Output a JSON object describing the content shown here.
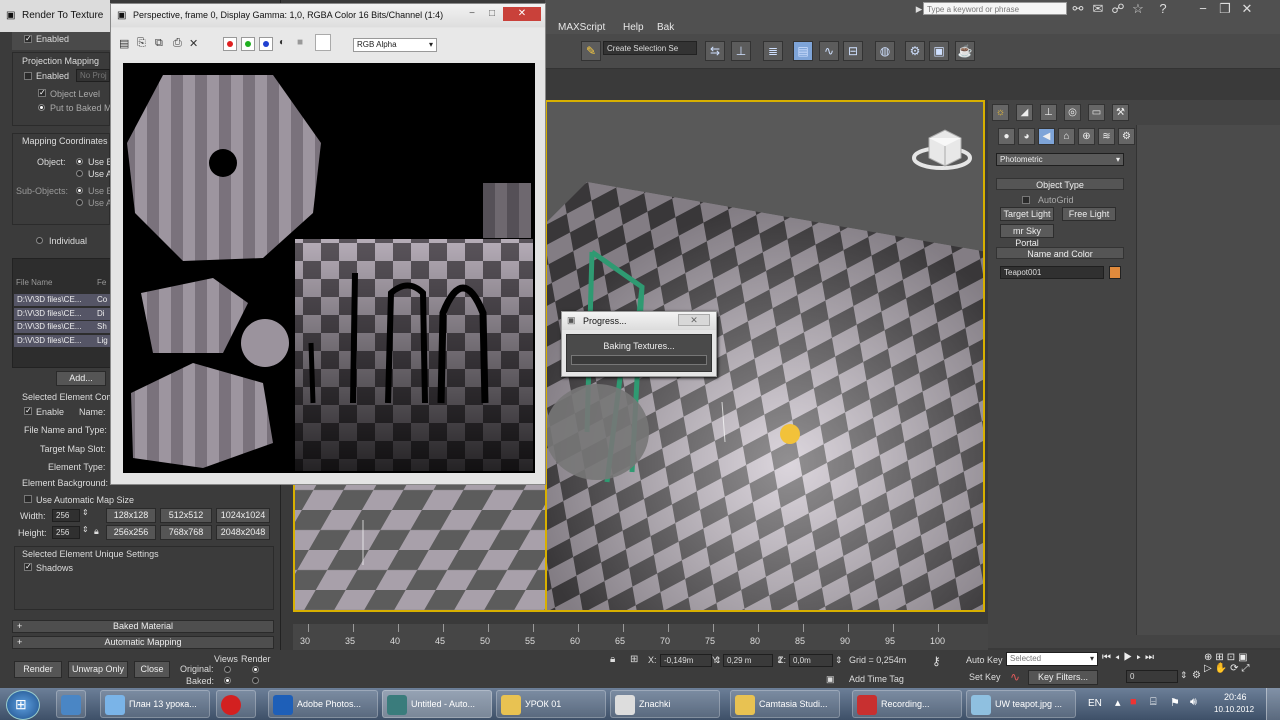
{
  "colors": {
    "accent": "#d8b000",
    "object_color": "#e08a3c"
  },
  "topbar": {
    "menus": [
      "MAXScript",
      "Help",
      "Bak"
    ],
    "search_placeholder": "Type a keyword or phrase"
  },
  "toolbar": {
    "selection_set_placeholder": "Create Selection Se"
  },
  "render_to_texture": {
    "title": "Render To Texture",
    "enabled": "Enabled",
    "projection_mapping": "Projection Mapping",
    "proj_enabled": "Enabled",
    "proj_field": "No Proj",
    "object_level": "Object Level",
    "put_to_baked": "Put to Baked M",
    "mapping_coordinates": "Mapping Coordinates",
    "object_label": "Object:",
    "object_opt1": "Use E",
    "object_opt2": "Use A",
    "sub_objects_label": "Sub-Objects:",
    "sub_opt1": "Use E",
    "sub_opt2": "Use A",
    "individual": "Individual",
    "file_name_header": "File Name",
    "file_col2_header": "Fe",
    "file_rows": [
      {
        "name": "D:\\V\\3D files\\CE...",
        "el": "Co"
      },
      {
        "name": "D:\\V\\3D files\\CE...",
        "el": "Di"
      },
      {
        "name": "D:\\V\\3D files\\CE...",
        "el": "Sh"
      },
      {
        "name": "D:\\V\\3D files\\CE...",
        "el": "Lig"
      }
    ],
    "add_button": "Add...",
    "selected_element_common": "Selected Element Com",
    "enable": "Enable",
    "name_label": "Name:",
    "file_name_type": "File Name and Type:",
    "target_map_slot": "Target Map Slot:",
    "element_type": "Element Type:",
    "element_background": "Element Background:",
    "use_auto_map_size": "Use Automatic Map Size",
    "width_label": "Width:",
    "height_label": "Height:",
    "width_value": "256",
    "height_value": "256",
    "size_buttons": [
      "128x128",
      "512x512",
      "1024x1024",
      "256x256",
      "768x768",
      "2048x2048"
    ],
    "unique_settings": "Selected Element Unique Settings",
    "shadows": "Shadows",
    "baked_material": "Baked Material",
    "automatic_mapping": "Automatic Mapping",
    "render_button": "Render",
    "unwrap_only_button": "Unwrap Only",
    "close_button": "Close",
    "views_label": "Views",
    "render_label": "Render",
    "original_label": "Original:",
    "baked_label": "Baked:"
  },
  "frame_buffer": {
    "title": "Perspective, frame 0, Display Gamma: 1,0, RGBA Color 16 Bits/Channel (1:4)",
    "channel_select": "RGB Alpha"
  },
  "progress": {
    "title": "Progress...",
    "message": "Baking Textures..."
  },
  "command_panel": {
    "category": "Photometric",
    "object_type": "Object Type",
    "autogrid": "AutoGrid",
    "target_light": "Target Light",
    "free_light": "Free Light",
    "sky_portal": "mr Sky Portal",
    "name_and_color": "Name and Color",
    "object_name": "Teapot001"
  },
  "timeline": {
    "ticks": [
      "30",
      "35",
      "40",
      "45",
      "50",
      "55",
      "60",
      "65",
      "70",
      "75",
      "80",
      "85",
      "90",
      "95",
      "100"
    ]
  },
  "status": {
    "x_label": "X:",
    "x_value": "-0,149m",
    "y_label": "Y:",
    "y_value": "0,29 m",
    "z_label": "Z:",
    "z_value": "0,0m",
    "grid": "Grid = 0,254m",
    "add_time_tag": "Add Time Tag",
    "auto_key": "Auto Key",
    "set_key": "Set Key",
    "selected": "Selected",
    "key_filters": "Key Filters...",
    "frame_value": "0"
  },
  "taskbar": {
    "items": [
      "План 13 урока...",
      "Adobe Photos...",
      "Untitled - Auto...",
      "УРОК 01",
      "Znachki",
      "Camtasia Studi...",
      "Recording...",
      "UW teapot.jpg ..."
    ],
    "language": "EN",
    "time": "20:46",
    "date": "10.10.2012"
  }
}
